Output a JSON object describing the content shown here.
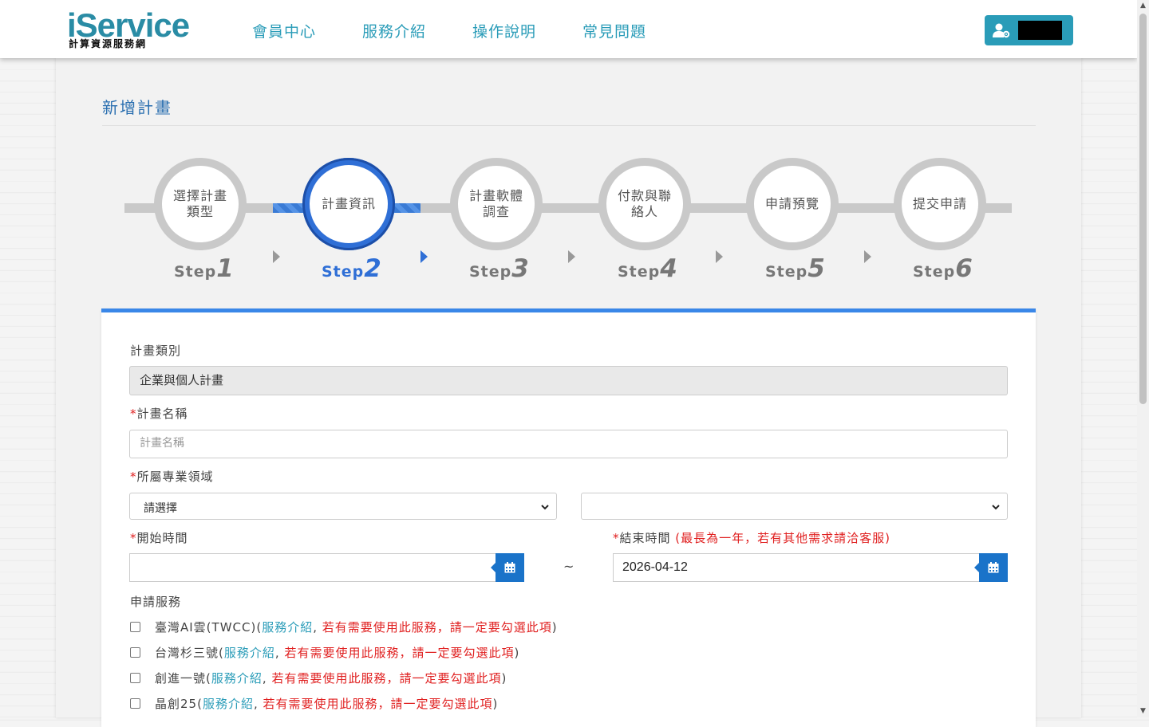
{
  "header": {
    "logo_main": "iService",
    "logo_sub": "計算資源服務網",
    "nav": [
      "會員中心",
      "服務介紹",
      "操作說明",
      "常見問題"
    ]
  },
  "page": {
    "title": "新增計畫"
  },
  "stepper": {
    "steps": [
      {
        "label": "選擇計畫類型",
        "prefix": "Step",
        "num": "1"
      },
      {
        "label": "計畫資訊",
        "prefix": "Step",
        "num": "2"
      },
      {
        "label": "計畫軟體調查",
        "prefix": "Step",
        "num": "3"
      },
      {
        "label": "付款與聯絡人",
        "prefix": "Step",
        "num": "4"
      },
      {
        "label": "申請預覽",
        "prefix": "Step",
        "num": "5"
      },
      {
        "label": "提交申請",
        "prefix": "Step",
        "num": "6"
      }
    ],
    "active_step": 2
  },
  "form": {
    "category_label": "計畫類別",
    "category_value": "企業與個人計畫",
    "required_mark": "*",
    "name_label": "計畫名稱",
    "name_placeholder": "計畫名稱",
    "field_label": "所屬專業領域",
    "field_select_value": "請選擇",
    "field_sub_select_value": "",
    "start_label": "開始時間",
    "start_value": "",
    "range_separator": "~",
    "end_label": "結束時間",
    "end_note": "(最長為一年，若有其他需求請洽客服)",
    "end_value": "2026-04-12",
    "services_label": "申請服務",
    "services": [
      {
        "name": "臺灣AI雲(TWCC)",
        "link": "服務介紹",
        "note": "若有需要使用此服務，請一定要勾選此項"
      },
      {
        "name": "台灣杉三號",
        "link": "服務介紹",
        "note": "若有需要使用此服務，請一定要勾選此項"
      },
      {
        "name": "創進一號",
        "link": "服務介紹",
        "note": "若有需要使用此服務，請一定要勾選此項"
      },
      {
        "name": "晶創25",
        "link": "服務介紹",
        "note": "若有需要使用此服務，請一定要勾選此項"
      }
    ]
  },
  "colors": {
    "brand": "#2a9cb8",
    "active_step": "#2f6fd6",
    "required": "#e02020",
    "calendar_button": "#1a73c9"
  }
}
